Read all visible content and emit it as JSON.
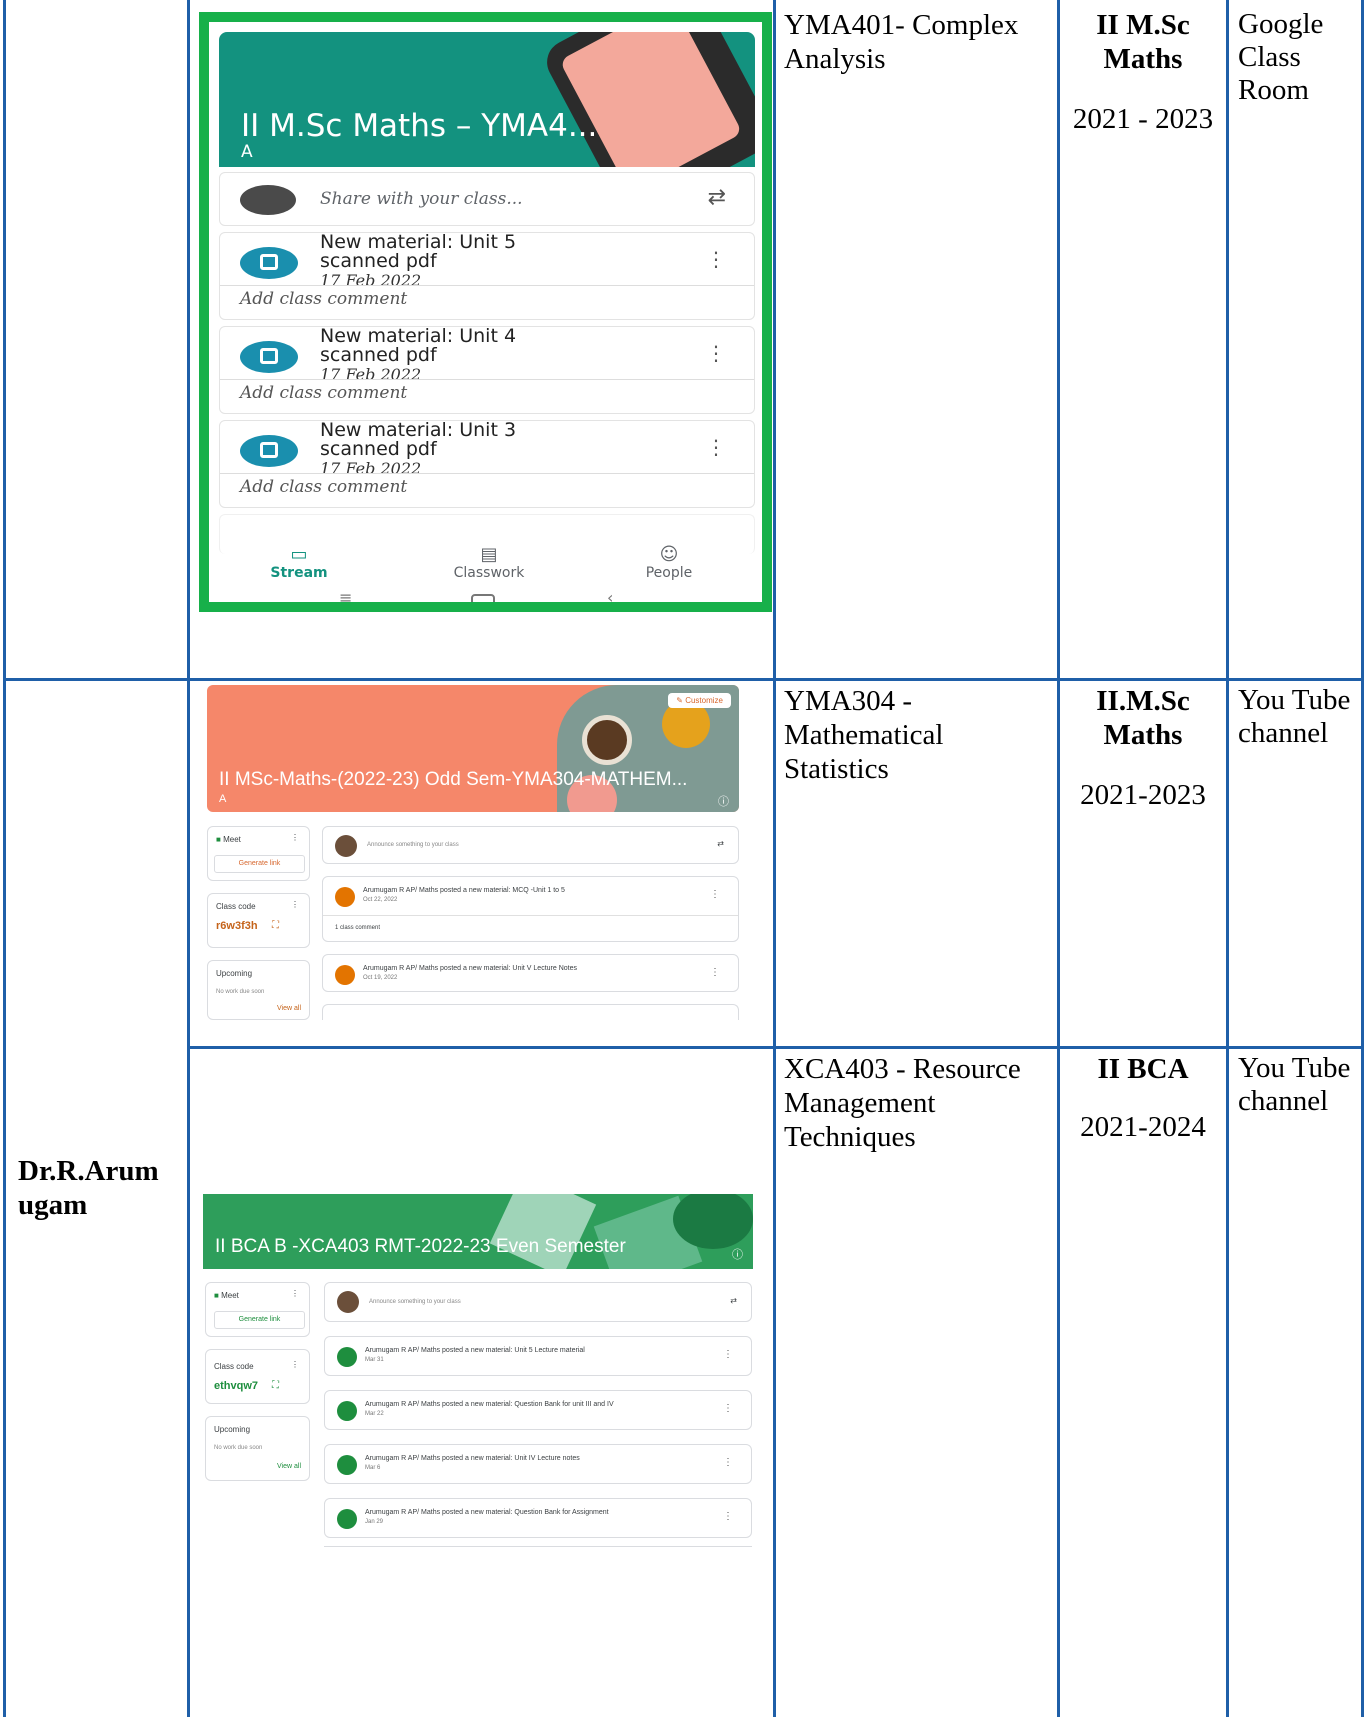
{
  "rows": [
    {
      "course": "YMA401- Complex Analysis",
      "class_line1": "II M.Sc",
      "class_line2": "Maths",
      "batch": "2021 - 2023",
      "platform": "Google Class Room",
      "screenshot": {
        "title": "II M.Sc Maths – YMA4...",
        "section": "A",
        "share_placeholder": "Share with your class...",
        "posts": [
          {
            "line1": "New material: Unit 5",
            "line2": "scanned pdf",
            "date": "17 Feb 2022",
            "comment": "Add class comment"
          },
          {
            "line1": "New material: Unit 4",
            "line2": "scanned pdf",
            "date": "17 Feb 2022",
            "comment": "Add class comment"
          },
          {
            "line1": "New material: Unit 3",
            "line2": "scanned pdf",
            "date": "17 Feb 2022",
            "comment": "Add class comment"
          }
        ],
        "nav": [
          "Stream",
          "Classwork",
          "People"
        ]
      }
    },
    {
      "course": "YMA304 - Mathematical Statistics",
      "class_line1": "II.M.Sc",
      "class_line2": "Maths",
      "batch": "2021-2023",
      "platform": "You Tube channel",
      "screenshot": {
        "title": "II MSc-Maths-(2022-23) Odd Sem-YMA304-MATHEM...",
        "section": "A",
        "customize": "Customize",
        "meet": "Meet",
        "generate_link": "Generate link",
        "class_code_label": "Class code",
        "class_code": "r6w3f3h",
        "upcoming": "Upcoming",
        "no_work": "No work due soon",
        "view_all": "View all",
        "announce": "Announce something to your class",
        "posts": [
          {
            "text": "Arumugam R AP/ Maths posted a new material: MCQ -Unit 1 to 5",
            "date": "Oct 22, 2022",
            "comment": "1 class comment"
          },
          {
            "text": "Arumugam R AP/ Maths posted a new material: Unit V Lecture Notes",
            "date": "Oct 19, 2022"
          }
        ]
      }
    },
    {
      "teacher": "Dr.R.Arumugam",
      "teacher_line1": "Dr.R.Arum",
      "teacher_line2": "ugam",
      "course": "XCA403 - Resource Management Techniques",
      "class_line1": "II BCA",
      "batch": "2021-2024",
      "platform": "You Tube channel",
      "screenshot": {
        "title": "II BCA B -XCA403 RMT-2022-23 Even Semester",
        "meet": "Meet",
        "generate_link": "Generate link",
        "class_code_label": "Class code",
        "class_code": "ethvqw7",
        "upcoming": "Upcoming",
        "no_work": "No work due soon",
        "view_all": "View all",
        "announce": "Announce something to your class",
        "posts": [
          {
            "text": "Arumugam R AP/ Maths posted a new material: Unit 5 Lecture material",
            "date": "Mar 31"
          },
          {
            "text": "Arumugam R AP/ Maths posted a new material: Question Bank for unit III and IV",
            "date": "Mar 22"
          },
          {
            "text": "Arumugam R AP/ Maths posted a new material: Unit IV Lecture notes",
            "date": "Mar 6"
          },
          {
            "text": "Arumugam R AP/ Maths posted a new material: Question Bank for Assignment",
            "date": "Jan 29"
          }
        ]
      }
    }
  ],
  "colors": {
    "grid": "#1f5fa8",
    "phone_frame": "#17b04a",
    "phone_header": "#13927f",
    "orange_banner": "#f5876a",
    "green_banner": "#2e9e5b",
    "class_code_orange": "#c5631a",
    "class_code_green": "#1e8e3e"
  }
}
